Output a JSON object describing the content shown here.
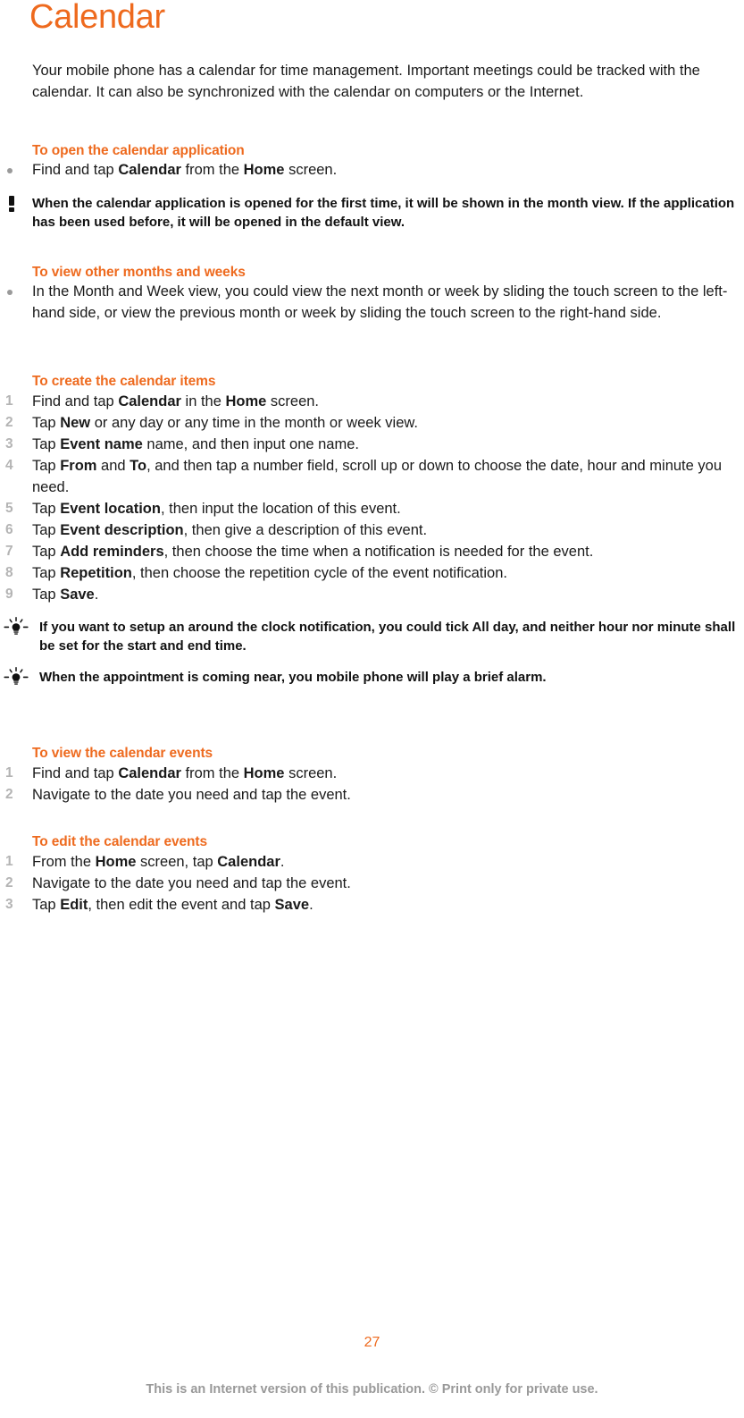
{
  "page": {
    "title": "Calendar",
    "title_color": "#ee6a1e",
    "heading_color": "#ee6a1e",
    "number_color": "#b4b4b4",
    "body_color": "#1a1a1a",
    "page_number": "27",
    "copyright": "This is an Internet version of this publication. © Print only for private use."
  },
  "intro": {
    "text": "Your mobile phone has a calendar for time management. Important meetings could be tracked with the calendar. It can also be synchronized with the calendar on computers or the Internet."
  },
  "sections": [
    {
      "id": "open-calendar-application",
      "heading": "To open the calendar application",
      "list_type": "bullet",
      "items": [
        {
          "parts": [
            {
              "t": "Find and tap ",
              "b": false
            },
            {
              "t": "Calendar",
              "b": true
            },
            {
              "t": " from the ",
              "b": false
            },
            {
              "t": "Home",
              "b": true
            },
            {
              "t": " screen.",
              "b": false
            }
          ]
        }
      ],
      "callouts": [
        {
          "type": "note",
          "icon": "exclamation-icon",
          "text": "When the calendar application is opened for the first time, it will be shown in the month view. If the application has been used before, it will be opened in the default view."
        }
      ]
    },
    {
      "id": "view-other-months-and-weeks",
      "heading": "To view other months and weeks",
      "list_type": "bullet",
      "items": [
        {
          "parts": [
            {
              "t": "In the Month and Week view, you could view the next month or week by sliding the touch screen to the left-hand side, or view the previous month or week by sliding the touch screen to the right-hand side.",
              "b": false
            }
          ]
        }
      ],
      "callouts": []
    },
    {
      "id": "create-the-calendar-items",
      "heading": "To create the calendar items",
      "list_type": "number",
      "items": [
        {
          "n": "1",
          "parts": [
            {
              "t": "Find and tap ",
              "b": false
            },
            {
              "t": "Calendar",
              "b": true
            },
            {
              "t": " in the ",
              "b": false
            },
            {
              "t": "Home",
              "b": true
            },
            {
              "t": " screen.",
              "b": false
            }
          ]
        },
        {
          "n": "2",
          "parts": [
            {
              "t": "Tap ",
              "b": false
            },
            {
              "t": "New",
              "b": true
            },
            {
              "t": " or any day or any time in the month or week view.",
              "b": false
            }
          ]
        },
        {
          "n": "3",
          "parts": [
            {
              "t": "Tap ",
              "b": false
            },
            {
              "t": "Event name",
              "b": true
            },
            {
              "t": " name, and then input one name.",
              "b": false
            }
          ]
        },
        {
          "n": "4",
          "parts": [
            {
              "t": "Tap ",
              "b": false
            },
            {
              "t": "From",
              "b": true
            },
            {
              "t": " and ",
              "b": false
            },
            {
              "t": "To",
              "b": true
            },
            {
              "t": ", and then tap a number field, scroll up or down to choose the date, hour and minute you need.",
              "b": false
            }
          ]
        },
        {
          "n": "5",
          "parts": [
            {
              "t": "Tap ",
              "b": false
            },
            {
              "t": "Event location",
              "b": true
            },
            {
              "t": ", then input the location of this event.",
              "b": false
            }
          ]
        },
        {
          "n": "6",
          "parts": [
            {
              "t": "Tap ",
              "b": false
            },
            {
              "t": "Event description",
              "b": true
            },
            {
              "t": ", then give a description of this event.",
              "b": false
            }
          ]
        },
        {
          "n": "7",
          "parts": [
            {
              "t": "Tap ",
              "b": false
            },
            {
              "t": "Add reminders",
              "b": true
            },
            {
              "t": ", then choose the time when a notification is needed for the event.",
              "b": false
            }
          ]
        },
        {
          "n": "8",
          "parts": [
            {
              "t": "Tap ",
              "b": false
            },
            {
              "t": "Repetition",
              "b": true
            },
            {
              "t": ", then choose the repetition cycle of the event notification.",
              "b": false
            }
          ]
        },
        {
          "n": "9",
          "parts": [
            {
              "t": "Tap ",
              "b": false
            },
            {
              "t": "Save",
              "b": true
            },
            {
              "t": ".",
              "b": false
            }
          ]
        }
      ],
      "callouts": [
        {
          "type": "tip",
          "icon": "lightbulb-icon",
          "text": "If you want to setup an around the clock notification, you could tick All day, and neither hour nor minute shall be set for the start and end time."
        },
        {
          "type": "tip",
          "icon": "lightbulb-icon",
          "text": "When the appointment is coming near, you mobile phone will play a brief alarm."
        }
      ]
    },
    {
      "id": "view-the-calendar-events",
      "heading": "To view the calendar events",
      "list_type": "number",
      "items": [
        {
          "n": "1",
          "parts": [
            {
              "t": "Find and tap ",
              "b": false
            },
            {
              "t": "Calendar",
              "b": true
            },
            {
              "t": " from the ",
              "b": false
            },
            {
              "t": "Home",
              "b": true
            },
            {
              "t": " screen.",
              "b": false
            }
          ]
        },
        {
          "n": "2",
          "parts": [
            {
              "t": "Navigate to the date you need and tap the event.",
              "b": false
            }
          ]
        }
      ],
      "callouts": []
    },
    {
      "id": "edit-the-calendar-events",
      "heading": "To edit the calendar events",
      "list_type": "number",
      "items": [
        {
          "n": "1",
          "parts": [
            {
              "t": "From the ",
              "b": false
            },
            {
              "t": "Home",
              "b": true
            },
            {
              "t": " screen, tap ",
              "b": false
            },
            {
              "t": "Calendar",
              "b": true
            },
            {
              "t": ".",
              "b": false
            }
          ]
        },
        {
          "n": "2",
          "parts": [
            {
              "t": "Navigate to the date you need and tap the event.",
              "b": false
            }
          ]
        },
        {
          "n": "3",
          "parts": [
            {
              "t": "Tap ",
              "b": false
            },
            {
              "t": "Edit",
              "b": true
            },
            {
              "t": ", then edit the event and tap ",
              "b": false
            },
            {
              "t": "Save",
              "b": true
            },
            {
              "t": ".",
              "b": false
            }
          ]
        }
      ],
      "callouts": []
    }
  ]
}
